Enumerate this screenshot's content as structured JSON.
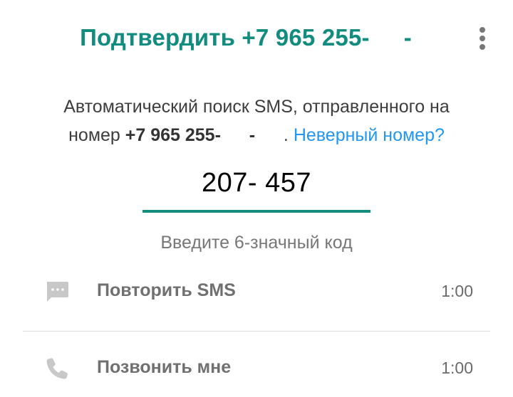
{
  "header": {
    "title_prefix": "Подтвердить +7 965 255-",
    "title_suffix": "-",
    "menu_icon": "more-vert-icon"
  },
  "description": {
    "line1": "Автоматический поиск SMS, отправленного на",
    "line2_prefix": "номер ",
    "phone_prefix": "+7 965 255-",
    "phone_middle": "-",
    "period": ".",
    "wrong_number_link": "Неверный номер?"
  },
  "code_input": {
    "value": "207- 457",
    "hint": "Введите 6-значный код"
  },
  "options": [
    {
      "label": "Повторить SMS",
      "timer": "1:00",
      "icon": "message-icon"
    },
    {
      "label": "Позвонить мне",
      "timer": "1:00",
      "icon": "phone-icon"
    }
  ],
  "colors": {
    "accent": "#128c7e",
    "link": "#2196f3",
    "icon_gray": "#c8c8c8"
  }
}
